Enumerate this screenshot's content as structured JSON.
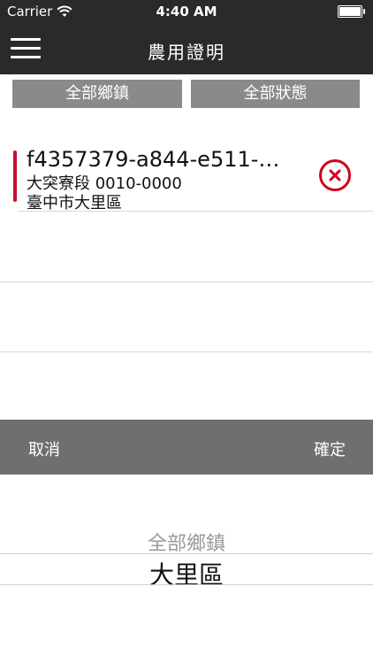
{
  "status_bar": {
    "carrier": "Carrier",
    "time": "4:40 AM",
    "wifi_icon": "wifi-icon",
    "battery_icon": "battery-icon"
  },
  "nav": {
    "title": "農用證明",
    "menu_icon": "hamburger-menu-icon"
  },
  "filters": {
    "town_label": "全部鄉鎮",
    "status_label": "全部狀態"
  },
  "list": {
    "items": [
      {
        "title": "f4357379-a844-e511-…",
        "land": "大突寮段 0010-0000",
        "district": "臺中市大里區"
      }
    ]
  },
  "picker": {
    "cancel_label": "取消",
    "confirm_label": "確定",
    "options": [
      "全部鄉鎮",
      "大里區"
    ],
    "selected": "大里區"
  },
  "colors": {
    "nav_background": "#2a2a2a",
    "filter_button": "#8a8a8a",
    "picker_toolbar": "#6f6f6f",
    "accent_red": "#c8102e",
    "delete_red": "#d0021b"
  }
}
